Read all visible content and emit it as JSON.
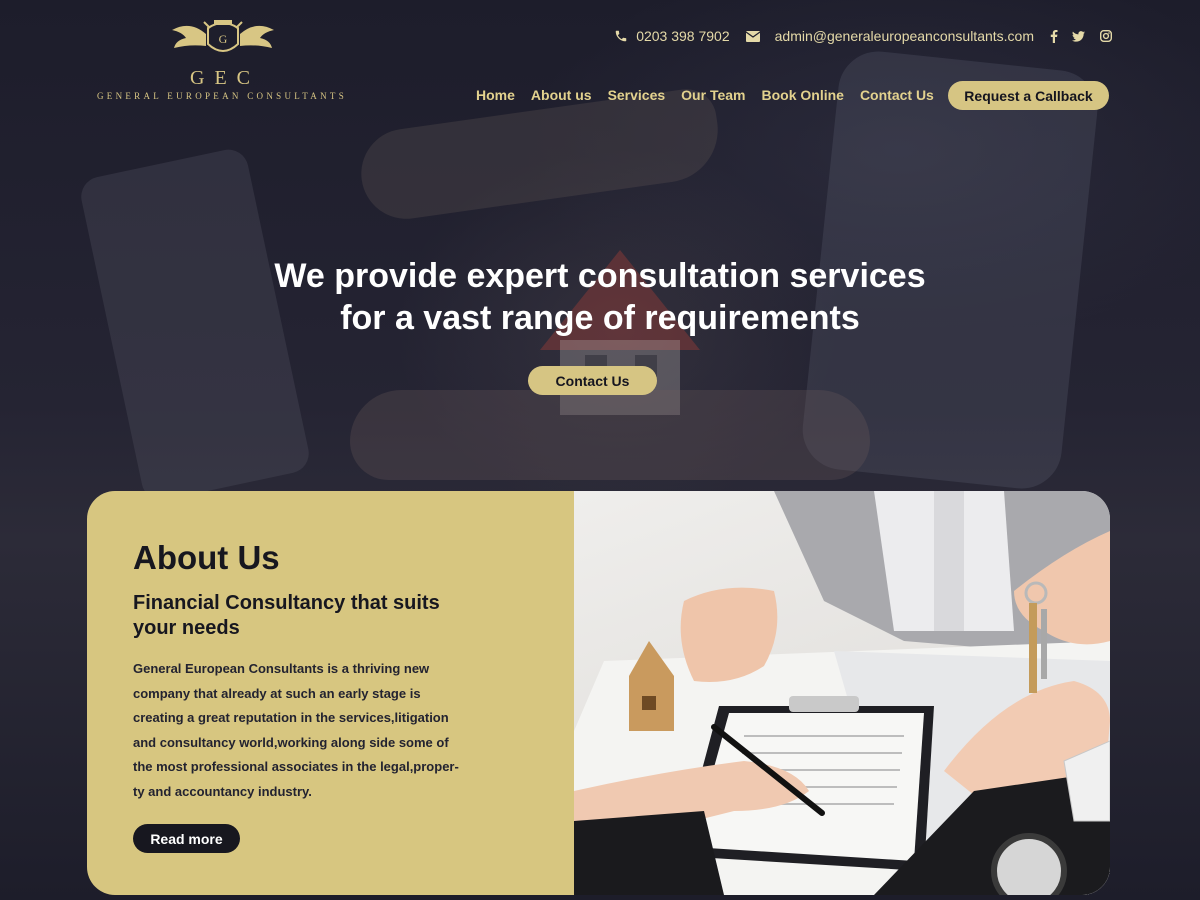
{
  "brand": {
    "initials": "GEC",
    "name": "GENERAL EUROPEAN CONSULTANTS",
    "gold": "#d6c583",
    "dark": "#17171f"
  },
  "contact": {
    "phone": "0203 398 7902",
    "email": "admin@generaleuropeanconsultants.com",
    "icons": [
      "phone-icon",
      "envelope-icon",
      "facebook-icon",
      "twitter-icon",
      "instagram-icon"
    ]
  },
  "nav": {
    "items": [
      "Home",
      "About us",
      "Services",
      "Our Team",
      "Book Online",
      "Contact Us"
    ],
    "cta": "Request a Callback"
  },
  "hero": {
    "line1": "We provide expert consultation services",
    "line2": "for a vast range of requirements",
    "button": "Contact Us"
  },
  "about": {
    "title": "About Us",
    "subtitle_line1": "Financial Consultancy that suits",
    "subtitle_line2": "your needs",
    "text_lines": [
      "General European Consultants is a thriving new",
      "company that already at such an early stage is",
      "creating a great reputation in the services,litigation",
      "and consultancy world,working along side some of",
      "the most professional associates in the legal,proper-",
      "ty and accountancy industry."
    ],
    "button": "Read more"
  }
}
